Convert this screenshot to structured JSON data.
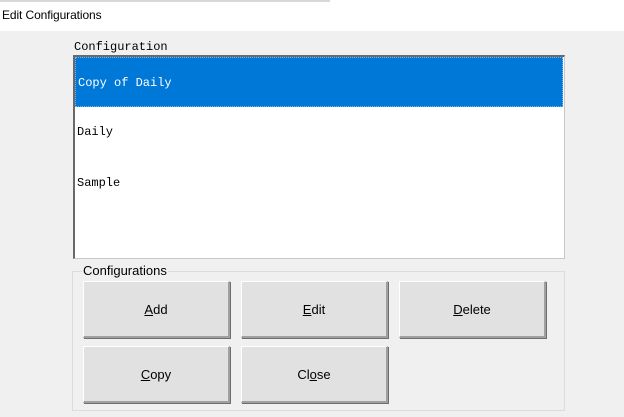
{
  "window": {
    "title": "Edit Configurations"
  },
  "list": {
    "header": "Configuration",
    "items": [
      {
        "label": "Copy of Daily",
        "selected": true
      },
      {
        "label": "Daily",
        "selected": false
      },
      {
        "label": "Sample",
        "selected": false
      }
    ]
  },
  "group": {
    "label": "Configurations",
    "buttons": {
      "add": {
        "pre": "",
        "accel": "A",
        "post": "dd"
      },
      "edit": {
        "pre": "",
        "accel": "E",
        "post": "dit"
      },
      "delete": {
        "pre": "",
        "accel": "D",
        "post": "elete"
      },
      "copy": {
        "pre": "",
        "accel": "C",
        "post": "opy"
      },
      "close": {
        "pre": "Cl",
        "accel": "o",
        "post": "se"
      }
    }
  },
  "colors": {
    "selection": "#0078d7",
    "selection_text": "#ffffff",
    "dialog_bg": "#f0f0f0",
    "button_bg": "#e1e1e1"
  }
}
